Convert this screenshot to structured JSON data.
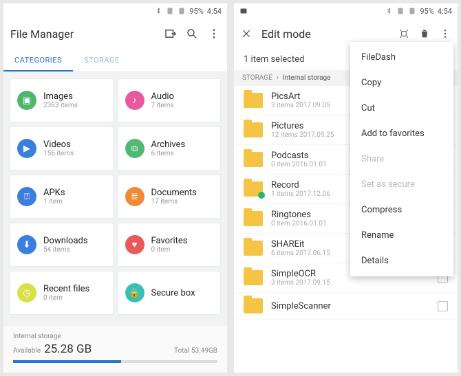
{
  "status": {
    "battery": "95%",
    "time": "4:54"
  },
  "left": {
    "title": "File Manager",
    "tabs": {
      "categories": "CATEGORIES",
      "storage": "STORAGE"
    },
    "cards": [
      {
        "label": "Images",
        "sub": "2363 items",
        "color": "#4fb66e",
        "symbol": "▣"
      },
      {
        "label": "Audio",
        "sub": "7 items",
        "color": "#e85aa0",
        "symbol": "♪"
      },
      {
        "label": "Videos",
        "sub": "156 items",
        "color": "#3b7ee0",
        "symbol": "▶"
      },
      {
        "label": "Archives",
        "sub": "6 items",
        "color": "#50b976",
        "symbol": "⧉"
      },
      {
        "label": "APKs",
        "sub": "1 item",
        "color": "#3b7ee0",
        "symbol": "⍰"
      },
      {
        "label": "Documents",
        "sub": "17 items",
        "color": "#f08a3a",
        "symbol": "≣"
      },
      {
        "label": "Downloads",
        "sub": "54 items",
        "color": "#3b7ee0",
        "symbol": "⬇"
      },
      {
        "label": "Favorites",
        "sub": "0 item",
        "color": "#e85a5a",
        "symbol": "♥"
      },
      {
        "label": "Recent files",
        "sub": "0 item",
        "color": "#d7e249",
        "symbol": "◷"
      },
      {
        "label": "Secure box",
        "sub": "",
        "color": "#35c1b5",
        "symbol": "🔒"
      }
    ],
    "storage": {
      "title": "Internal storage",
      "available_label": "Available",
      "available_value": "25.28 GB",
      "total_label": "Total",
      "total_value": "53.49GB",
      "used_percent": 53
    }
  },
  "right": {
    "title": "Edit mode",
    "selection": "1 item selected",
    "breadcrumb": {
      "root": "STORAGE",
      "path": "Internal storage"
    },
    "files": [
      {
        "name": "PicsArt",
        "sub": "3 items   2017.09.05",
        "dl": false
      },
      {
        "name": "Pictures",
        "sub": "12 items   2017.09.25",
        "dl": false
      },
      {
        "name": "Podcasts",
        "sub": "0 item   2016.01.01",
        "dl": false
      },
      {
        "name": "Record",
        "sub": "1 items   2017.12.06",
        "dl": true
      },
      {
        "name": "Ringtones",
        "sub": "0 item   2016.01.01",
        "dl": false
      },
      {
        "name": "SHAREit",
        "sub": "6 items   2017.06.15",
        "dl": false
      },
      {
        "name": "SimpleOCR",
        "sub": "3 items   2017.09.15",
        "dl": false
      },
      {
        "name": "SimpleScanner",
        "sub": "",
        "dl": false
      }
    ],
    "menu": [
      {
        "label": "FileDash",
        "disabled": false
      },
      {
        "label": "Copy",
        "disabled": false
      },
      {
        "label": "Cut",
        "disabled": false
      },
      {
        "label": "Add to favorites",
        "disabled": false
      },
      {
        "label": "Share",
        "disabled": true
      },
      {
        "label": "Set as secure",
        "disabled": true
      },
      {
        "label": "Compress",
        "disabled": false
      },
      {
        "label": "Rename",
        "disabled": false
      },
      {
        "label": "Details",
        "disabled": false
      }
    ]
  }
}
